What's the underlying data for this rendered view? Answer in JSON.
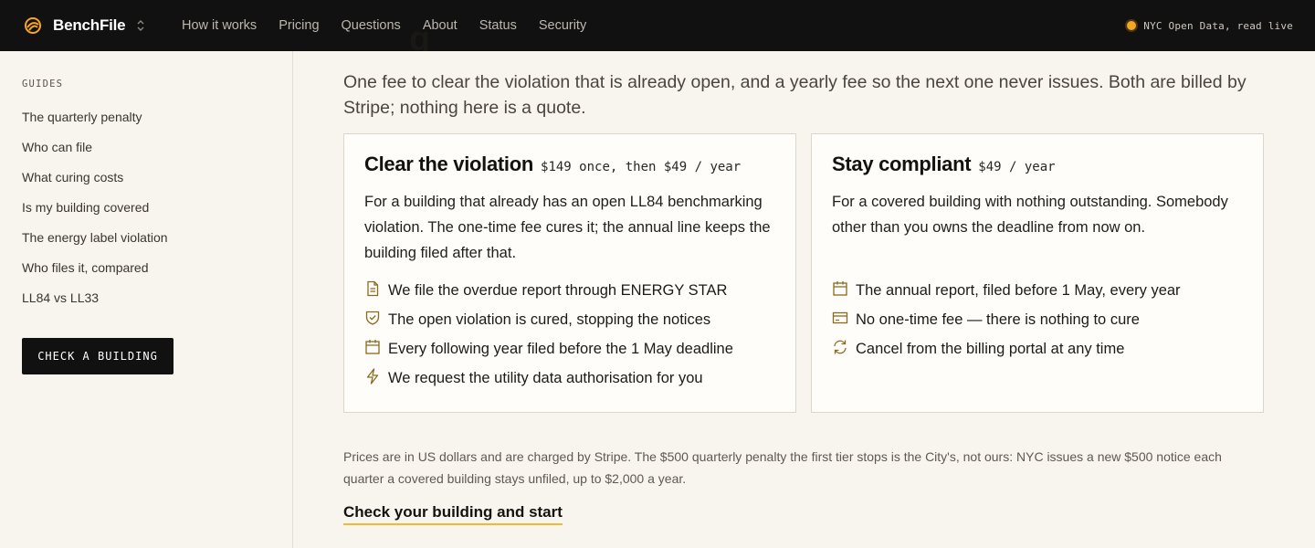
{
  "brand": {
    "name": "BenchFile"
  },
  "nav": {
    "items": [
      "How it works",
      "Pricing",
      "Questions",
      "About",
      "Status",
      "Security"
    ]
  },
  "status": {
    "live_text": "NYC Open Data, read live"
  },
  "sidebar": {
    "heading": "GUIDES",
    "items": [
      "The quarterly penalty",
      "Who can file",
      "What curing costs",
      "Is my building covered",
      "The energy label violation",
      "Who files it, compared",
      "LL84 vs LL33"
    ],
    "cta_label": "CHECK A BUILDING"
  },
  "main": {
    "intro": "One fee to clear the violation that is already open, and a yearly fee so the next one never issues. Both are billed by Stripe; nothing here is a quote.",
    "cards": [
      {
        "title": "Clear the violation",
        "price": "$149 once, then $49 / year",
        "description": "For a building that already has an open LL84 benchmarking violation. The one-time fee cures it; the annual line keeps the building filed after that.",
        "features": [
          {
            "icon": "document-icon",
            "text": "We file the overdue report through ENERGY STAR"
          },
          {
            "icon": "shield-check-icon",
            "text": "The open violation is cured, stopping the notices"
          },
          {
            "icon": "calendar-icon",
            "text": "Every following year filed before the 1 May deadline"
          },
          {
            "icon": "lightning-icon",
            "text": "We request the utility data authorisation for you"
          }
        ]
      },
      {
        "title": "Stay compliant",
        "price": "$49 / year",
        "description": "For a covered building with nothing outstanding. Somebody other than you owns the deadline from now on.",
        "features": [
          {
            "icon": "calendar-icon",
            "text": "The annual report, filed before 1 May, every year"
          },
          {
            "icon": "credit-card-icon",
            "text": "No one-time fee — there is nothing to cure"
          },
          {
            "icon": "refresh-icon",
            "text": "Cancel from the billing portal at any time"
          }
        ]
      }
    ],
    "fine_print": "Prices are in US dollars and are charged by Stripe. The $500 quarterly penalty the first tier stops is the City's, not ours: NYC issues a new $500 notice each quarter a covered building stays unfiled, up to $2,000 a year.",
    "start_link": "Check your building and start"
  },
  "colors": {
    "accent": "#f5a623",
    "icon": "#8a6a1f",
    "topbar": "#111111",
    "background": "#f8f4ee"
  }
}
